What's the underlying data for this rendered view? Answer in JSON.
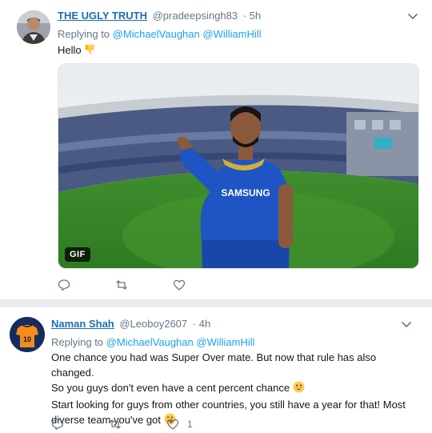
{
  "tweets": [
    {
      "name": "THE UGLY TRUTH",
      "handle": "@pradeepsingh83",
      "time": "· 5h",
      "replying_prefix": "Replying to",
      "mentions": [
        "@MichaelVaughan",
        "@WilliamHill"
      ],
      "text": "Hello",
      "emoji": "thumbs-down",
      "media": {
        "badge": "GIF",
        "jersey_text": "SAMSUNG"
      },
      "actions": {
        "reply": "",
        "retweet": "",
        "like": ""
      }
    },
    {
      "name": "Naman Shah",
      "handle": "@Leoboy2607",
      "time": "· 4h",
      "replying_prefix": "Replying to",
      "mentions": [
        "@MichaelVaughan",
        "@WilliamHill"
      ],
      "text_line1": "One chance you had was Super Over mate. But now that rule has also changed.",
      "text_line2": "So you guys don't even have a cent percent chance",
      "text_line3": "Start looking for guys from other countries, you still have a year for that! Most",
      "text_line4": "diverse team you've got",
      "actions": {
        "reply": "",
        "retweet": "",
        "like": "1"
      }
    }
  ],
  "colors": {
    "link": "#1da1f2",
    "name": "#1b6eb5",
    "muted": "#657786",
    "divider": "#e6ecf0"
  },
  "icons": [
    "chevron-down-icon",
    "reply-icon",
    "retweet-icon",
    "like-icon",
    "thumbs-down-emoji",
    "grin-emoji",
    "wink-tongue-emoji"
  ]
}
